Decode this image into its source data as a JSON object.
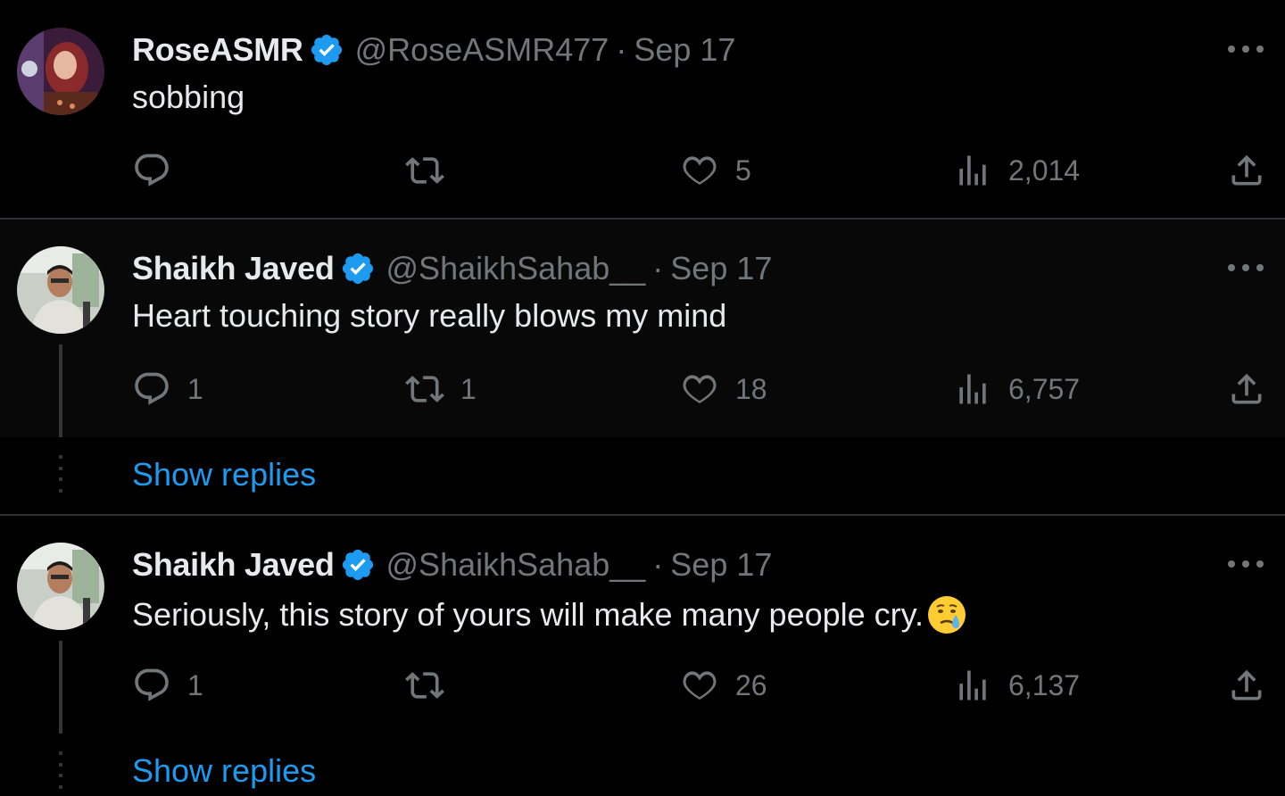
{
  "colors": {
    "background": "#000000",
    "text": "#e7e9ea",
    "muted": "#71767b",
    "link": "#1d9bf0",
    "verified": "#1d9bf0",
    "divider": "#2f3336"
  },
  "icons": {
    "reply": "comment-bubble-icon",
    "retweet": "retweet-icon",
    "like": "heart-icon",
    "views": "bar-chart-icon",
    "share": "share-icon",
    "more": "more-dots-icon",
    "verified": "verified-badge-icon"
  },
  "tweets": [
    {
      "name": "RoseASMR",
      "handle": "@RoseASMR477",
      "separator": "·",
      "date": "Sep 17",
      "text": "sobbing",
      "reply_count": "",
      "retweet_count": "",
      "like_count": "5",
      "view_count": "2,014"
    },
    {
      "name": "Shaikh Javed",
      "handle": "@ShaikhSahab__",
      "separator": "·",
      "date": "Sep 17",
      "text": "Heart touching story really blows my mind",
      "reply_count": "1",
      "retweet_count": "1",
      "like_count": "18",
      "view_count": "6,757",
      "show_replies": "Show replies"
    },
    {
      "name": "Shaikh Javed",
      "handle": "@ShaikhSahab__",
      "separator": "·",
      "date": "Sep 17",
      "text": "Seriously, this story of yours will make many people cry.",
      "emoji": "crying-face-emoji",
      "reply_count": "1",
      "retweet_count": "",
      "like_count": "26",
      "view_count": "6,137",
      "show_replies": "Show replies"
    }
  ]
}
